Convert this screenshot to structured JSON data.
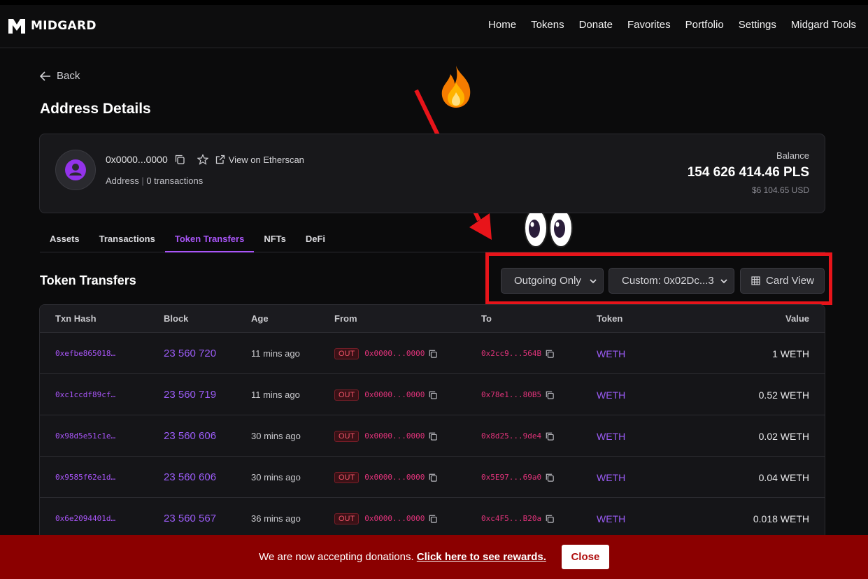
{
  "brand": {
    "name": "MIDGARD"
  },
  "nav": [
    "Home",
    "Tokens",
    "Donate",
    "Favorites",
    "Portfolio",
    "Settings",
    "Midgard Tools"
  ],
  "back_label": "Back",
  "page_title": "Address Details",
  "address": {
    "short": "0x0000...0000",
    "etherscan_label": "View on Etherscan",
    "type": "Address",
    "tx_count": "0 transactions",
    "balance_label": "Balance",
    "balance": "154 626 414.46 PLS",
    "balance_usd": "$6 104.65 USD"
  },
  "tabs": [
    "Assets",
    "Transactions",
    "Token Transfers",
    "NFTs",
    "DeFi"
  ],
  "active_tab": "Token Transfers",
  "section_title": "Token Transfers",
  "filters": {
    "direction": "Outgoing Only",
    "token": "Custom: 0x02Dc...3",
    "view_button": "Card View"
  },
  "table": {
    "headers": [
      "Txn Hash",
      "Block",
      "Age",
      "From",
      "To",
      "Token",
      "Value"
    ],
    "rows": [
      {
        "hash": "0xefbe865018…",
        "block": "23 560 720",
        "age": "11 mins ago",
        "dir": "OUT",
        "from": "0x0000...0000",
        "to": "0x2cc9...564B",
        "token": "WETH",
        "value": "1 WETH"
      },
      {
        "hash": "0xc1ccdf89cf…",
        "block": "23 560 719",
        "age": "11 mins ago",
        "dir": "OUT",
        "from": "0x0000...0000",
        "to": "0x78e1...80B5",
        "token": "WETH",
        "value": "0.52 WETH"
      },
      {
        "hash": "0x98d5e51c1e…",
        "block": "23 560 606",
        "age": "30 mins ago",
        "dir": "OUT",
        "from": "0x0000...0000",
        "to": "0x8d25...9de4",
        "token": "WETH",
        "value": "0.02 WETH"
      },
      {
        "hash": "0x9585f62e1d…",
        "block": "23 560 606",
        "age": "30 mins ago",
        "dir": "OUT",
        "from": "0x0000...0000",
        "to": "0x5E97...69a0",
        "token": "WETH",
        "value": "0.04 WETH"
      },
      {
        "hash": "0x6e2094401d…",
        "block": "23 560 567",
        "age": "36 mins ago",
        "dir": "OUT",
        "from": "0x0000...0000",
        "to": "0xc4F5...B20a",
        "token": "WETH",
        "value": "0.018 WETH"
      }
    ]
  },
  "banner": {
    "text": "We are now accepting donations.",
    "link": "Click here to see rewards.",
    "close": "Close"
  },
  "colors": {
    "accent": "#a855f7",
    "highlight": "#e8141a",
    "banner": "#8b0000",
    "out_badge": "#f05468"
  }
}
